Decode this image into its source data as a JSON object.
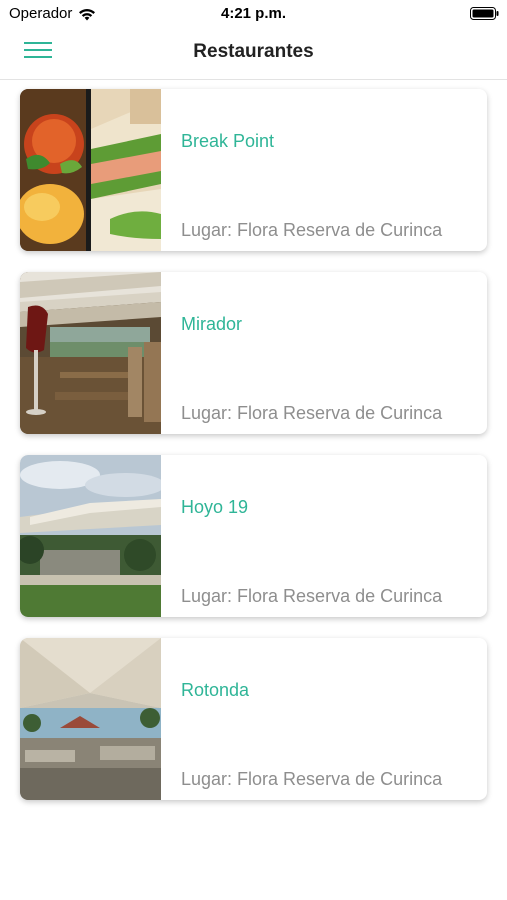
{
  "status_bar": {
    "carrier": "Operador",
    "time": "4:21 p.m."
  },
  "nav": {
    "title": "Restaurantes",
    "menu_icon": "hamburger-menu-icon"
  },
  "colors": {
    "accent": "#2fb597",
    "secondary_text": "#8e8e8e"
  },
  "restaurants": [
    {
      "name": "Break Point",
      "place": "Lugar: Flora Reserva de Curinca",
      "image": "food-platter-photo"
    },
    {
      "name": "Mirador",
      "place": "Lugar: Flora Reserva de Curinca",
      "image": "dining-terrace-photo"
    },
    {
      "name": "Hoyo 19",
      "place": "Lugar: Flora Reserva de Curinca",
      "image": "outdoor-canopy-photo"
    },
    {
      "name": "Rotonda",
      "place": "Lugar: Flora Reserva de Curinca",
      "image": "tent-pavilion-photo"
    }
  ]
}
